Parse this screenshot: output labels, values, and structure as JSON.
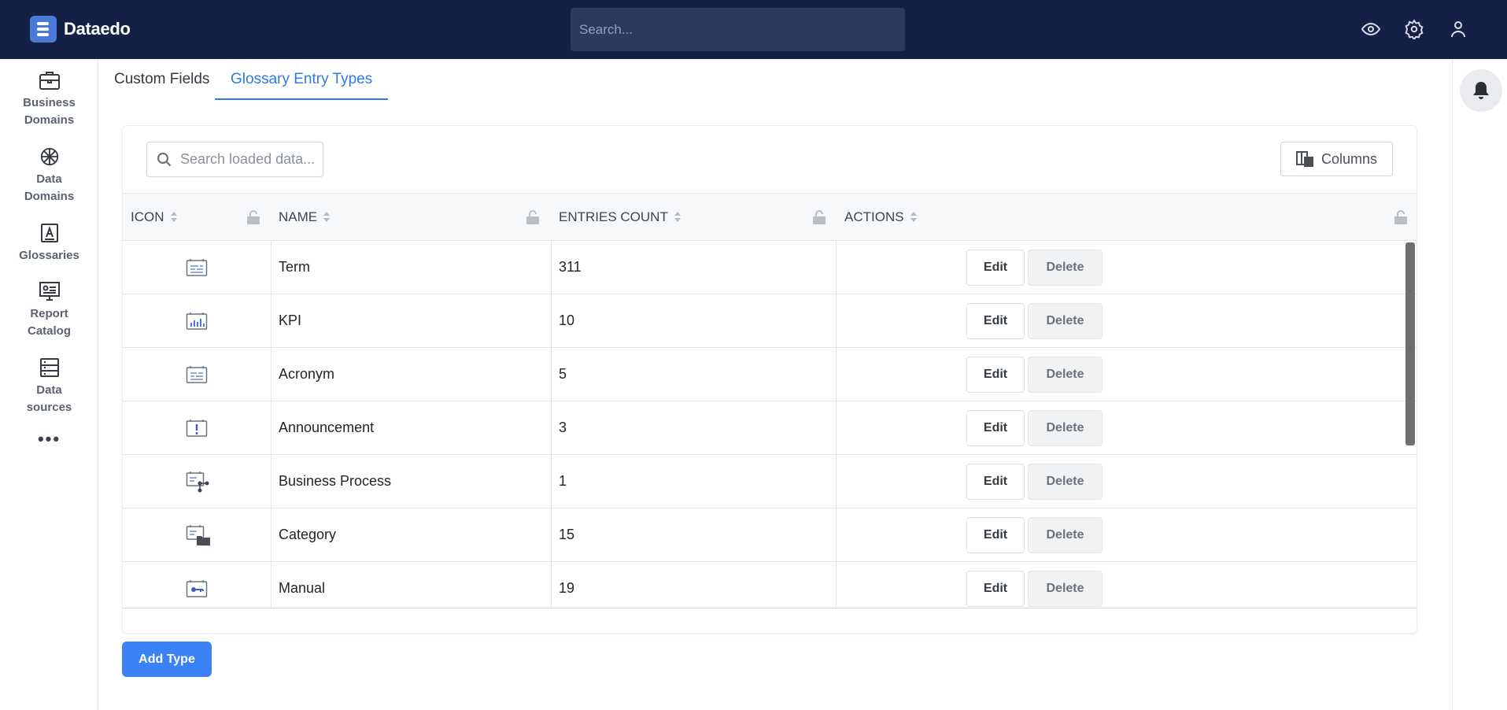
{
  "app": {
    "brand": "Dataedo"
  },
  "topbar": {
    "search_placeholder": "Search..."
  },
  "sidebar": {
    "items": [
      {
        "label_1": "Business",
        "label_2": "Domains",
        "icon": "briefcase-icon"
      },
      {
        "label_1": "Data",
        "label_2": "Domains",
        "icon": "globe-grid-icon"
      },
      {
        "label_1": "Glossaries",
        "label_2": "",
        "icon": "glossary-book-icon"
      },
      {
        "label_1": "Report",
        "label_2": "Catalog",
        "icon": "report-board-icon"
      },
      {
        "label_1": "Data",
        "label_2": "sources",
        "icon": "database-list-icon"
      }
    ],
    "more": "•••"
  },
  "tabs": [
    {
      "label": "Custom Fields",
      "active": false
    },
    {
      "label": "Glossary Entry Types",
      "active": true
    }
  ],
  "grid": {
    "search_placeholder": "Search loaded data...",
    "columns_label": "Columns",
    "headers": [
      "ICON",
      "NAME",
      "ENTRIES COUNT",
      "ACTIONS"
    ],
    "rows": [
      {
        "icon": "term-icon",
        "name": "Term",
        "count": "311"
      },
      {
        "icon": "kpi-chart-icon",
        "name": "KPI",
        "count": "10"
      },
      {
        "icon": "acronym-icon",
        "name": "Acronym",
        "count": "5"
      },
      {
        "icon": "announcement-icon",
        "name": "Announcement",
        "count": "3"
      },
      {
        "icon": "business-process-icon",
        "name": "Business Process",
        "count": "1"
      },
      {
        "icon": "category-folder-icon",
        "name": "Category",
        "count": "15"
      },
      {
        "icon": "manual-key-icon",
        "name": "Manual",
        "count": "19"
      }
    ],
    "edit_label": "Edit",
    "delete_label": "Delete"
  },
  "add_type_label": "Add Type",
  "colors": {
    "topbar": "#142147",
    "accent": "#2f7ae5",
    "primary_button": "#3b82f6"
  }
}
